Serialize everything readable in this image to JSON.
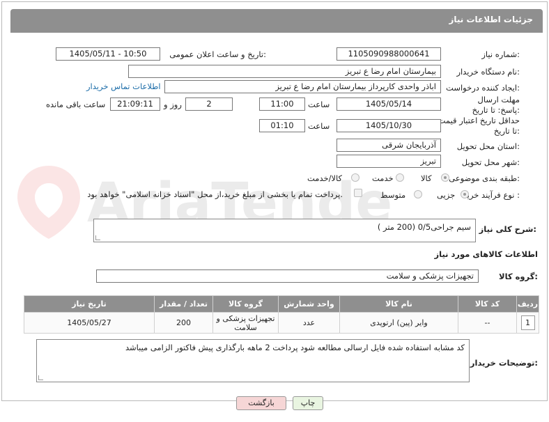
{
  "header": {
    "title": "جزئیات اطلاعات نیاز"
  },
  "fields": {
    "need_number_label": "شماره نیاز:",
    "need_number": "1105090988000641",
    "announce_label": "تاریخ و ساعت اعلان عمومی:",
    "announce_value": "1405/05/11 - 10:50",
    "buyer_label": "نام دستگاه خریدار:",
    "buyer_value": "بیمارستان امام رضا  ع  تبریز",
    "creator_label": "ایجاد کننده درخواست:",
    "creator_value": "اباذر واحدی کارپرداز بیمارستان امام رضا  ع  تبریز",
    "contact_link": "اطلاعات تماس خریدار",
    "deadline_label": "مهلت ارسال پاسخ: تا تاریخ:",
    "deadline_date": "1405/05/14",
    "time_label": "ساعت",
    "deadline_time": "11:00",
    "days_value": "2",
    "days_label": "روز و",
    "remaining_time": "21:09:11",
    "remaining_label": "ساعت باقی مانده",
    "validity_label": "حداقل تاریخ اعتبار قیمت: تا تاریخ:",
    "validity_date": "1405/10/30",
    "validity_time_label": "ساعت",
    "validity_time": "01:10",
    "province_label": "استان محل تحویل:",
    "province_value": "آذربایجان شرقی",
    "city_label": "شهر محل تحویل:",
    "city_value": "تبریز",
    "category_label": "طبقه بندی موضوعی:",
    "category_options": [
      "کالا",
      "خدمت",
      "کالا/خدمت"
    ],
    "process_label": "نوع فرآیند خرید :",
    "process_options": [
      "جزیی",
      "متوسط"
    ],
    "payment_note": "پرداخت تمام یا بخشی از مبلغ خرید،از محل \"اسناد خزانه اسلامی\" خواهد بود.",
    "description_label": "شرح کلی نیاز:",
    "description_value": "سیم جراحی0/5 (200 متر )",
    "goods_info_title": "اطلاعات کالاهای مورد نیاز",
    "goods_group_label": "گروه کالا:",
    "goods_group_value": "تجهیزات پزشکی و سلامت",
    "buyer_notes_label": "توضیحات خریدار:",
    "buyer_notes_value": "کد مشابه استفاده شده فایل ارسالی مطالعه شود پرداخت 2 ماهه بارگذاری پیش فاکتور  الزامی میباشد"
  },
  "table": {
    "headers": [
      "ردیف",
      "کد کالا",
      "نام کالا",
      "واحد شمارش",
      "گروه کالا",
      "تعداد / مقدار",
      "تاریخ نیاز"
    ],
    "rows": [
      [
        "1",
        "--",
        "وایر (پین) ارتوپدی",
        "عدد",
        "تجهیزات پزشکی و سلامت",
        "200",
        "1405/05/27"
      ]
    ]
  },
  "buttons": {
    "print": "چاپ",
    "back": "بازگشت"
  },
  "watermark": "AriaTender.net",
  "colors": {
    "header_bg": "#8f8f8f",
    "link": "#1b6ca8",
    "back_button_bg": "#f6d6d6",
    "print_button_bg": "#e9f5e1"
  }
}
